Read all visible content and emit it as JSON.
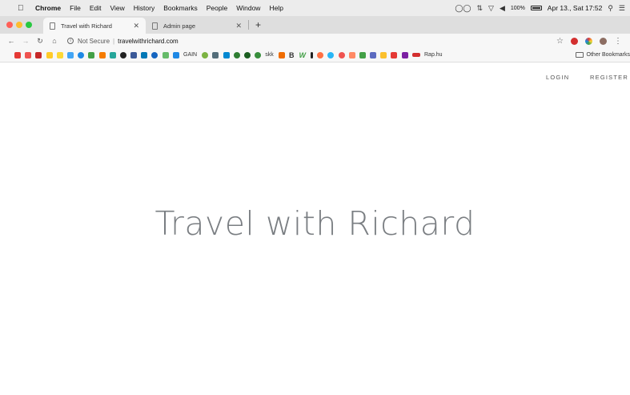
{
  "menubar": {
    "app_name": "Chrome",
    "items": [
      "File",
      "Edit",
      "View",
      "History",
      "Bookmarks",
      "People",
      "Window",
      "Help"
    ],
    "battery": "100%",
    "datetime": "Apr 13., Sat 17:52"
  },
  "tabs": [
    {
      "label": "Travel with Richard",
      "active": true
    },
    {
      "label": "Admin page",
      "active": false
    }
  ],
  "address_bar": {
    "security_label": "Not Secure",
    "url": "travelwithrichard.com"
  },
  "bookmarks": {
    "labeled": [
      "GAIN",
      "skk",
      "B",
      "W",
      "Rap.hu"
    ],
    "other_label": "Other Bookmarks"
  },
  "page": {
    "login_label": "LOGIN",
    "register_label": "REGISTER",
    "hero_title": "Travel with Richard"
  },
  "colors": {
    "traffic_red": "#ff5f57",
    "traffic_yellow": "#febc2e",
    "traffic_green": "#28c840",
    "hero_text": "#7a7e82"
  }
}
